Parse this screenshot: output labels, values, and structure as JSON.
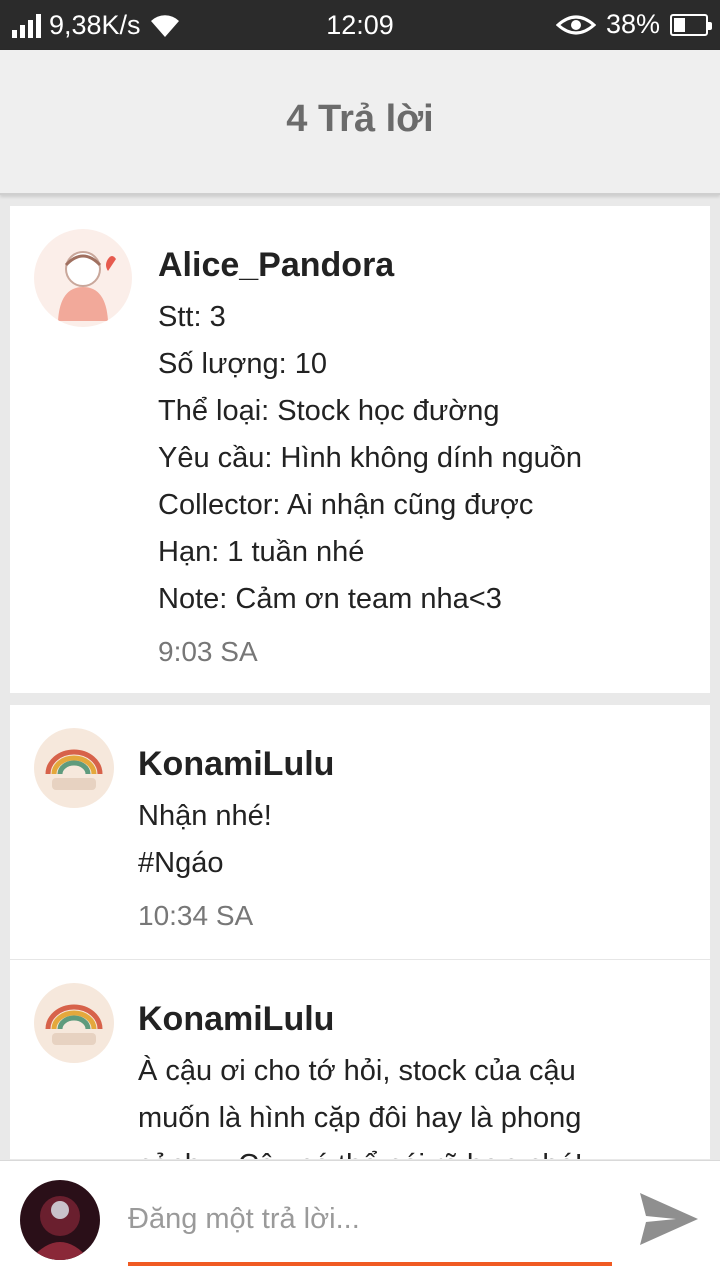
{
  "status": {
    "speed": "9,38K/s",
    "time": "12:09",
    "battery": "38%",
    "battery_level": 0.38
  },
  "header": {
    "title": "4 Trả lời"
  },
  "post": {
    "author": "Alice_Pandora",
    "lines": [
      "Stt: 3",
      "Số lượng: 10",
      "Thể loại: Stock học đường",
      "Yêu cầu: Hình không dính nguồn",
      "Collector: Ai nhận cũng được",
      "Hạn: 1 tuần nhé",
      "Note: Cảm ơn team nha<3"
    ],
    "time": "9:03 SA"
  },
  "replies": [
    {
      "author": "KonamiLulu",
      "lines": [
        "Nhận nhé!",
        "#Ngáo"
      ],
      "time": "10:34 SA"
    },
    {
      "author": "KonamiLulu",
      "lines": [
        "À cậu ơi cho tớ hỏi, stock của cậu",
        "muốn là hình cặp đôi hay là phong",
        "cảnh…  Cậu có thể nói rõ hơn nhé!"
      ]
    }
  ],
  "composer": {
    "placeholder": "Đăng một trả lời..."
  },
  "colors": {
    "accent": "#f05a22",
    "statusbar": "#2b2b2b",
    "header_bg": "#efefef"
  }
}
